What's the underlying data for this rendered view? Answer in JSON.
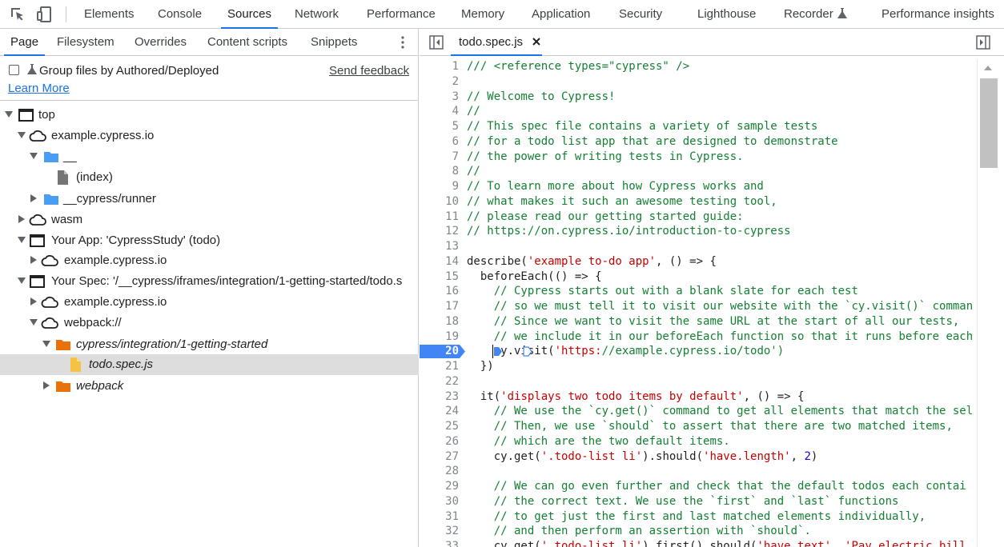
{
  "toolbar": {
    "inspect_icon": "inspect-element-icon",
    "device_icon": "device-toolbar-icon",
    "tabs": [
      {
        "label": "Elements"
      },
      {
        "label": "Console"
      },
      {
        "label": "Sources"
      },
      {
        "label": "Network"
      },
      {
        "label": "Performance"
      },
      {
        "label": "Memory"
      },
      {
        "label": "Application"
      },
      {
        "label": "Security"
      },
      {
        "label": "Lighthouse"
      },
      {
        "label": "Recorder"
      },
      {
        "label": "Performance insights"
      }
    ],
    "active_tab": "Sources"
  },
  "navigator": {
    "tabs": [
      {
        "label": "Page"
      },
      {
        "label": "Filesystem"
      },
      {
        "label": "Overrides"
      },
      {
        "label": "Content scripts"
      },
      {
        "label": "Snippets"
      }
    ],
    "active_tab": "Page",
    "group_label": "Group files by Authored/Deployed",
    "group_checked": false,
    "send_feedback": "Send feedback",
    "learn_more": "Learn More",
    "tree": [
      {
        "label": "top",
        "icon": "frame-icon",
        "expanded": true
      },
      {
        "label": "example.cypress.io",
        "icon": "cloud-icon",
        "expanded": true
      },
      {
        "label": "__",
        "icon": "folder-icon",
        "expanded": true
      },
      {
        "label": "(index)",
        "icon": "file-icon"
      },
      {
        "label": "__cypress/runner",
        "icon": "folder-icon",
        "expanded": false
      },
      {
        "label": "wasm",
        "icon": "cloud-icon",
        "expanded": false
      },
      {
        "label": "Your App: 'CypressStudy' (todo)",
        "icon": "frame-icon",
        "expanded": true
      },
      {
        "label": "example.cypress.io",
        "icon": "cloud-icon",
        "expanded": false
      },
      {
        "label": "Your Spec: '/__cypress/iframes/integration/1-getting-started/todo.s",
        "icon": "frame-icon",
        "expanded": true
      },
      {
        "label": "example.cypress.io",
        "icon": "cloud-icon",
        "expanded": false
      },
      {
        "label": "webpack://",
        "icon": "cloud-icon",
        "expanded": true
      },
      {
        "label": "cypress/integration/1-getting-started",
        "icon": "folder-icon",
        "expanded": true
      },
      {
        "label": "todo.spec.js",
        "icon": "file-icon",
        "selected": true
      },
      {
        "label": "webpack",
        "icon": "folder-icon",
        "expanded": false
      }
    ]
  },
  "editor": {
    "file_tab": "todo.spec.js",
    "breakpoint_line": "20",
    "lines": [
      {
        "n": "1",
        "t": "/// <reference types=\"cypress\" />"
      },
      {
        "n": "2",
        "t": ""
      },
      {
        "n": "3",
        "t": "// Welcome to Cypress!"
      },
      {
        "n": "4",
        "t": "//"
      },
      {
        "n": "5",
        "t": "// This spec file contains a variety of sample tests"
      },
      {
        "n": "6",
        "t": "// for a todo list app that are designed to demonstrate"
      },
      {
        "n": "7",
        "t": "// the power of writing tests in Cypress."
      },
      {
        "n": "8",
        "t": "//"
      },
      {
        "n": "9",
        "t": "// To learn more about how Cypress works and"
      },
      {
        "n": "10",
        "t": "// what makes it such an awesome testing tool,"
      },
      {
        "n": "11",
        "t": "// please read our getting started guide:"
      },
      {
        "n": "12",
        "t": "// https://on.cypress.io/introduction-to-cypress"
      },
      {
        "n": "13",
        "t": ""
      },
      {
        "n": "14",
        "t": "describe('example to-do app', () => {"
      },
      {
        "n": "15",
        "t": "  beforeEach(() => {"
      },
      {
        "n": "16",
        "t": "    // Cypress starts out with a blank slate for each test"
      },
      {
        "n": "17",
        "t": "    // so we must tell it to visit our website with the `cy.visit()` comman"
      },
      {
        "n": "18",
        "t": "    // Since we want to visit the same URL at the start of all our tests,"
      },
      {
        "n": "19",
        "t": "    // we include it in our beforeEach function so that it runs before each"
      },
      {
        "n": "20",
        "t": "    cy.visit('https://example.cypress.io/todo')"
      },
      {
        "n": "21",
        "t": "  })"
      },
      {
        "n": "22",
        "t": ""
      },
      {
        "n": "23",
        "t": "  it('displays two todo items by default', () => {"
      },
      {
        "n": "24",
        "t": "    // We use the `cy.get()` command to get all elements that match the sel"
      },
      {
        "n": "25",
        "t": "    // Then, we use `should` to assert that there are two matched items,"
      },
      {
        "n": "26",
        "t": "    // which are the two default items."
      },
      {
        "n": "27",
        "t": "    cy.get('.todo-list li').should('have.length', 2)"
      },
      {
        "n": "28",
        "t": ""
      },
      {
        "n": "29",
        "t": "    // We can go even further and check that the default todos each contai"
      },
      {
        "n": "30",
        "t": "    // the correct text. We use the `first` and `last` functions"
      },
      {
        "n": "31",
        "t": "    // to get just the first and last matched elements individually,"
      },
      {
        "n": "32",
        "t": "    // and then perform an assertion with `should`."
      },
      {
        "n": "33",
        "t": "    cy.get('.todo-list li').first().should('have.text', 'Pay electric bill"
      }
    ]
  },
  "colors": {
    "accent": "#1a73e8",
    "comment": "#148033",
    "string": "#c80000",
    "number": "#1c00cf",
    "breakpoint": "#4285f4",
    "folder_blue": "#4a9cf5",
    "folder_orange": "#e8710a",
    "file_gray": "#757575",
    "file_yellow": "#f5c342"
  }
}
